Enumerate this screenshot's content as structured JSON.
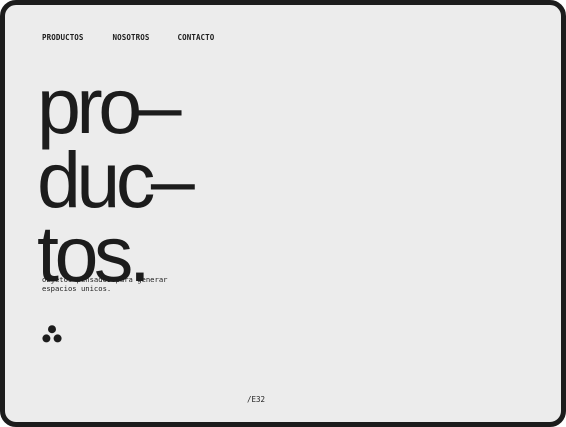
{
  "nav": {
    "items": [
      {
        "label": "PRODUCTOS"
      },
      {
        "label": "NOSOTROS"
      },
      {
        "label": "CONTACTO"
      }
    ]
  },
  "hero": {
    "lines": [
      "pro–",
      "duc–",
      "tos."
    ]
  },
  "tagline": {
    "line1": "objetos pensados para generar",
    "line2": "espacios unicos."
  },
  "logo": {
    "icon": "three-dots-logo-icon"
  },
  "footer": {
    "code": "/E32"
  },
  "colors": {
    "background": "#ececec",
    "frame": "#1c1c1c",
    "text": "#1c1c1c"
  }
}
